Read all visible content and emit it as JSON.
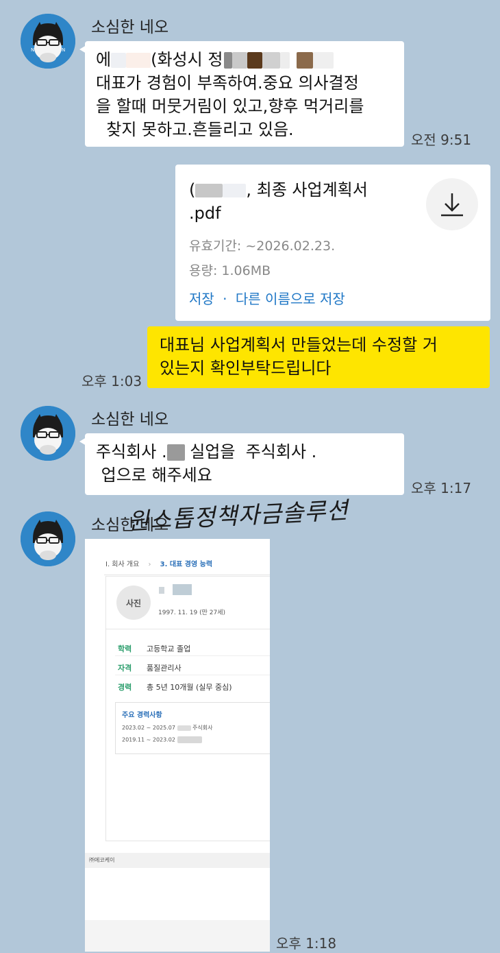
{
  "messages": {
    "m1": {
      "sender": "소심한 네오",
      "line1_prefix": "에",
      "line1_mid": "(화성시  정",
      "line2": "대표가 경험이  부족하여.중요 의사결정",
      "line3": "을 할때  머뭇거림이 있고,향후 먹거리를",
      "line4": "  찾지 못하고.흔들리고 있음.",
      "time": "오전 9:51"
    },
    "file": {
      "name_suffix": ", 최종 사업계획서",
      "ext": ".pdf",
      "expiry": "유효기간: ~2026.02.23.",
      "size": "용량: 1.06MB",
      "save_label": "저장",
      "sep": "·",
      "save_as_label": "다른 이름으로 저장",
      "download_icon": "download-icon"
    },
    "m2": {
      "line1": "대표님 사업계획서 만들었는데 수정할 거",
      "line2": "있는지 확인부탁드립니다",
      "time": "오후 1:03"
    },
    "m3": {
      "sender": "소심한 네오",
      "line1_a": "주식회사 .",
      "line1_b": " 실업을  주식회사 .",
      "line2": " 업으로 해주세요",
      "time": "오후 1:17"
    },
    "m4": {
      "sender": "소심한 네오",
      "watermark": "원스톱정책자금솔루션",
      "time": "오후 1:18"
    }
  },
  "document": {
    "breadcrumb_1": "I. 회사 개요",
    "breadcrumb_2": "3. 대표 경영 능력",
    "photo_label": "사진",
    "dob": "1997. 11. 19 (만 27세)",
    "fields": [
      {
        "label": "학력",
        "value": "고등학교 졸업"
      },
      {
        "label": "자격",
        "value": "품질관리사"
      },
      {
        "label": "경력",
        "value": "총 5년 10개월 (실무 중심)"
      }
    ],
    "career_title": "주요 경력사항",
    "career_1": "2023.02 ~ 2025.07",
    "career_1_tail": "주식회사",
    "career_2": "2019.11 ~ 2023.02",
    "footer": "㈜에코케이"
  },
  "colors": {
    "background": "#b2c7d9",
    "my_bubble": "#fee500",
    "link": "#1f77c6",
    "avatar": "#2f86c8"
  }
}
